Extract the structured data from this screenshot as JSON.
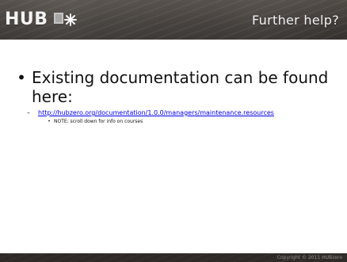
{
  "header": {
    "logo_text": "HUB",
    "section_title": "Further help?"
  },
  "content": {
    "bullet_text": "Existing documentation can be found here:",
    "link_text": "http://hubzero.org/documentation/1.0.0/managers/maintenance.resources",
    "note_text": "NOTE: scroll down for info on courses"
  },
  "footer": {
    "copyright_text": "Copyright © 2011 HUBzero"
  },
  "icons": {
    "logo_mark": "hub-logo-icon"
  }
}
